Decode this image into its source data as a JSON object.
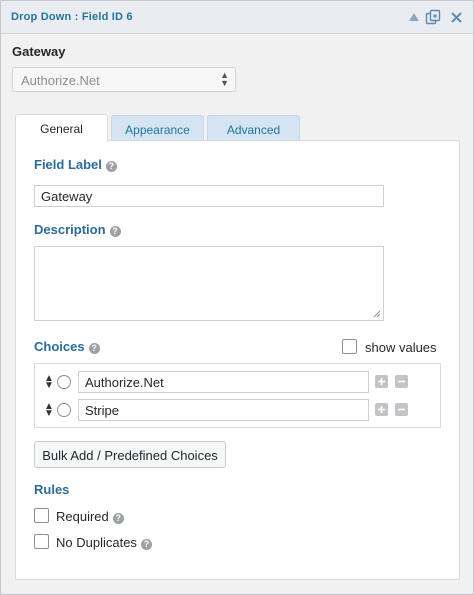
{
  "titlebar": {
    "title": "Drop Down : Field ID 6"
  },
  "field": {
    "name": "Gateway"
  },
  "gateway_select": {
    "value": "Authorize.Net"
  },
  "tabs": [
    {
      "label": "General"
    },
    {
      "label": "Appearance"
    },
    {
      "label": "Advanced"
    }
  ],
  "field_label": {
    "label": "Field Label",
    "value": "Gateway"
  },
  "description": {
    "label": "Description",
    "value": ""
  },
  "choices": {
    "label": "Choices",
    "show_values_label": "show values",
    "items": [
      {
        "value": "Authorize.Net"
      },
      {
        "value": "Stripe"
      }
    ],
    "bulk_button": "Bulk Add / Predefined Choices"
  },
  "rules": {
    "label": "Rules",
    "required_label": "Required",
    "no_duplicates_label": "No Duplicates"
  },
  "colors": {
    "accent": "#2d6c98",
    "title": "#21759b",
    "inactive_tab_bg": "#d5e4f2"
  },
  "icons": {
    "collapse": "triangle-up-icon",
    "duplicate": "duplicate-icon",
    "delete": "close-icon",
    "help": "help-icon",
    "sort": "sort-arrows-icon",
    "add": "plus-icon",
    "remove": "minus-icon"
  }
}
